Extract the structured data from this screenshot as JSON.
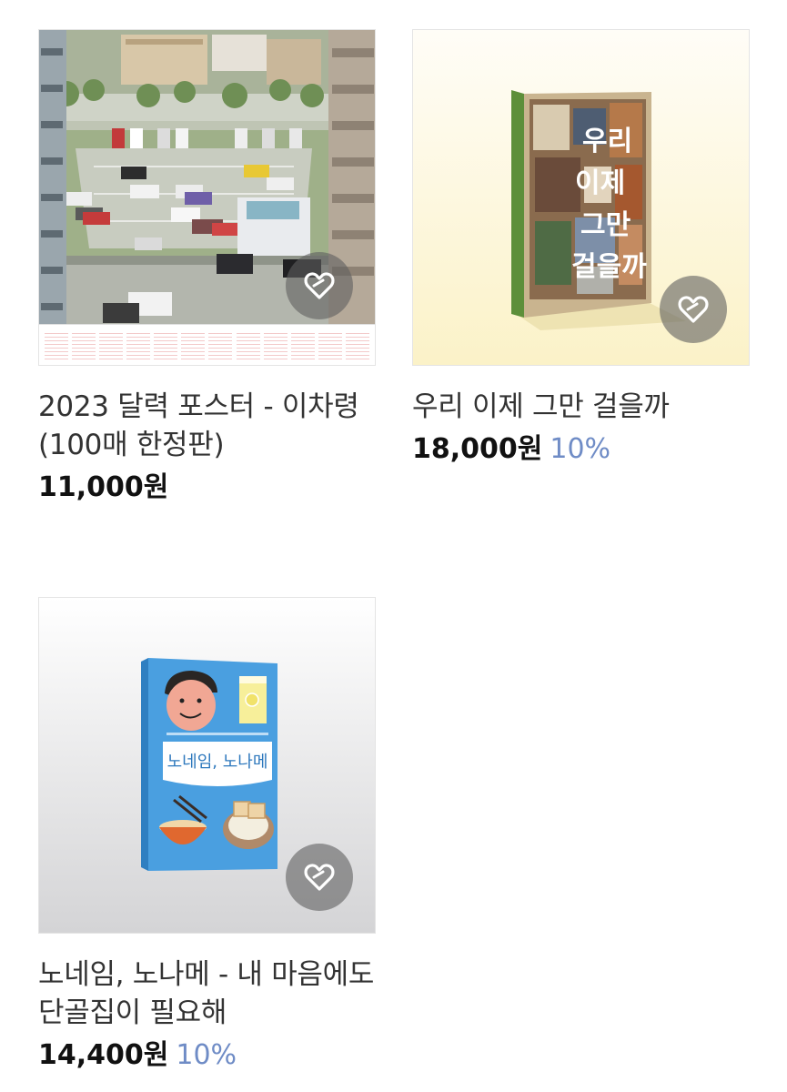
{
  "products": [
    {
      "title": "2023 달력 포스터 - 이차령 (100매 한정판)",
      "price": "11,000원",
      "discount": "",
      "like_icon": "heart-icon"
    },
    {
      "title": "우리 이제 그만 걸을까",
      "price": "18,000원",
      "discount": "10%",
      "like_icon": "heart-icon",
      "cover_title": "우리 이제 그만 걸을까"
    },
    {
      "title": "노네임, 노나메 - 내 마음에도 단골집이 필요해",
      "price": "14,400원",
      "discount": "10%",
      "like_icon": "heart-icon",
      "cover_title": "노네임, 노나메"
    }
  ],
  "colors": {
    "discount": "#6f8cc6",
    "like_button_bg": "#5f5f5f",
    "book2_cover": "#e8d9b5",
    "book2_spine": "#5d8f3a",
    "book3_cover": "#4a9fe0"
  }
}
